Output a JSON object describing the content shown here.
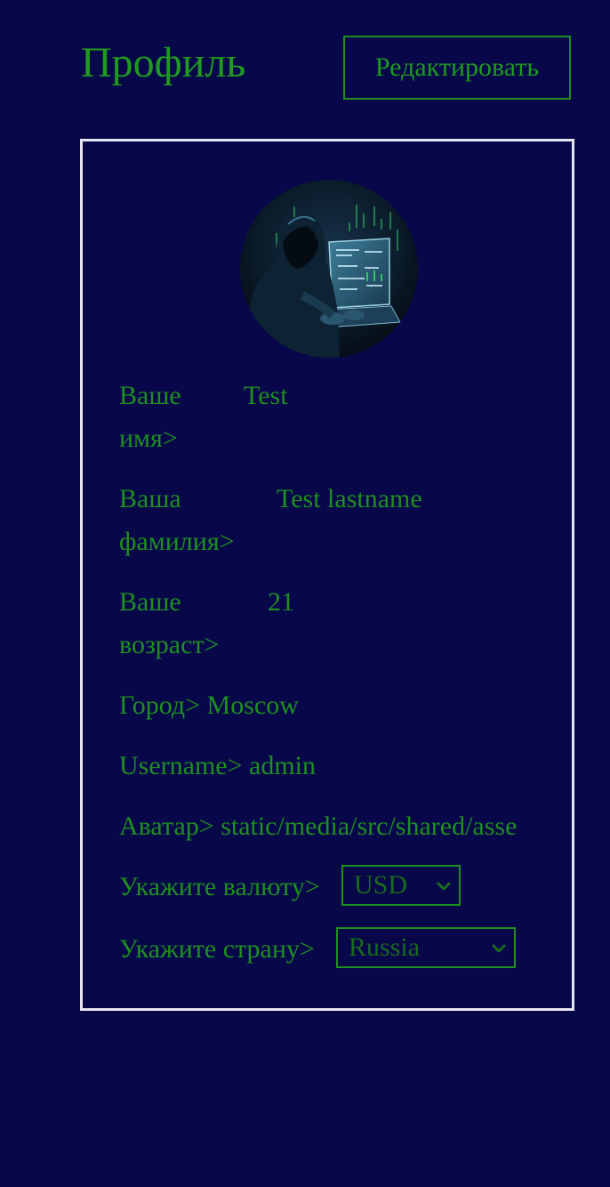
{
  "header": {
    "title": "Профиль",
    "edit_label": "Редактировать"
  },
  "profile": {
    "avatar_icon": "hooded-hacker-avatar",
    "name_label_1": "Ваше",
    "name_label_2": "имя>",
    "name_value": "Test",
    "lastname_label_1": "Ваша",
    "lastname_label_2": "фамилия>",
    "lastname_value": "Test lastname",
    "age_label_1": "Ваше",
    "age_label_2": "возраст>",
    "age_value": "21",
    "city_label": "Город>",
    "city_value": "Moscow",
    "username_label": "Username>",
    "username_value": "admin",
    "avatar_label": "Аватар>",
    "avatar_value": "static/media/src/shared/asse",
    "currency_label": "Укажите валюту>",
    "currency_value": "USD",
    "country_label": "Укажите страну>",
    "country_value": "Russia"
  },
  "colors": {
    "background": "#07074a",
    "accent_green": "#1f8f1f",
    "card_border": "#e6e6f0"
  }
}
